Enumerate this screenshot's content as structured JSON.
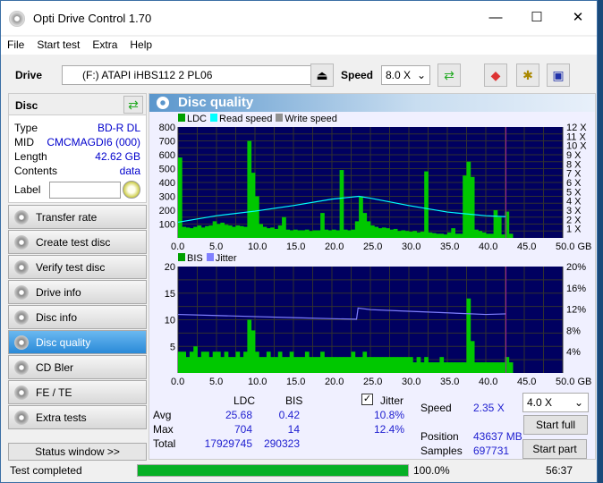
{
  "window": {
    "title": "Opti Drive Control 1.70",
    "minimize": "—",
    "maximize": "☐",
    "close": "✕"
  },
  "menu": [
    "File",
    "Start test",
    "Extra",
    "Help"
  ],
  "toolbar": {
    "drive_label": "Drive",
    "drive_value": "(F:)  ATAPI iHBS112  2 PL06",
    "speed_label": "Speed",
    "speed_value": "8.0 X"
  },
  "disc": {
    "header": "Disc",
    "rows": [
      {
        "k": "Type",
        "v": "BD-R DL"
      },
      {
        "k": "MID",
        "v": "CMCMAGDI6 (000)"
      },
      {
        "k": "Length",
        "v": "42.62 GB"
      },
      {
        "k": "Contents",
        "v": "data"
      }
    ],
    "label_key": "Label",
    "label_value": ""
  },
  "nav": [
    "Transfer rate",
    "Create test disc",
    "Verify test disc",
    "Drive info",
    "Disc info",
    "Disc quality",
    "CD Bler",
    "FE / TE",
    "Extra tests"
  ],
  "nav_active": 5,
  "status_window": "Status window >>",
  "panel_title": "Disc quality",
  "colors": {
    "ldc": "#00c800",
    "read": "#00ffff",
    "write": "#909090",
    "bis": "#00c800",
    "jitter": "#8080ff",
    "plot_bg": "#000060",
    "accent": "#2a8ad8"
  },
  "chart_data": [
    {
      "type": "bar",
      "legend": [
        "LDC",
        "Read speed",
        "Write speed"
      ],
      "xlim": [
        0,
        50
      ],
      "xunit": "GB",
      "ylim": [
        0,
        800
      ],
      "y2lim": [
        0,
        12
      ],
      "xticks": [
        "0.0",
        "5.0",
        "10.0",
        "15.0",
        "20.0",
        "25.0",
        "30.0",
        "35.0",
        "40.0",
        "45.0",
        "50.0 GB"
      ],
      "yticks": [
        "100",
        "200",
        "300",
        "400",
        "500",
        "600",
        "700",
        "800"
      ],
      "y2ticks": [
        "1 X",
        "2 X",
        "3 X",
        "4 X",
        "5 X",
        "6 X",
        "7 X",
        "8 X",
        "9 X",
        "10 X",
        "11 X",
        "12 X"
      ],
      "ldc_step_gb": 0.5,
      "ldc": [
        580,
        80,
        75,
        70,
        80,
        90,
        75,
        85,
        90,
        120,
        100,
        110,
        95,
        90,
        80,
        90,
        85,
        80,
        700,
        470,
        300,
        100,
        80,
        70,
        75,
        65,
        90,
        150,
        60,
        55,
        60,
        55,
        55,
        60,
        50,
        55,
        55,
        180,
        60,
        55,
        60,
        55,
        490,
        60,
        55,
        60,
        120,
        300,
        180,
        120,
        90,
        80,
        70,
        75,
        70,
        60,
        65,
        50,
        55,
        50,
        45,
        50,
        40,
        45,
        480,
        40,
        35,
        30,
        30,
        25,
        40,
        70,
        30,
        30,
        450,
        550,
        440,
        60,
        50,
        40,
        30,
        30,
        200,
        150,
        25,
        190,
        30
      ],
      "read_speed_x": [
        0,
        5,
        10,
        15,
        20,
        23.5,
        25,
        30,
        35,
        40,
        42.6
      ],
      "read_speed_y": [
        1.7,
        2.4,
        2.9,
        3.5,
        4.2,
        4.5,
        4.3,
        3.5,
        2.8,
        2.4,
        2.3
      ]
    },
    {
      "type": "bar",
      "legend": [
        "BIS",
        "Jitter"
      ],
      "xlim": [
        0,
        50
      ],
      "ylim": [
        0,
        20
      ],
      "y2lim": [
        0,
        20
      ],
      "xticks": [
        "0.0",
        "5.0",
        "10.0",
        "15.0",
        "20.0",
        "25.0",
        "30.0",
        "35.0",
        "40.0",
        "45.0",
        "50.0 GB"
      ],
      "yticks": [
        "5",
        "10",
        "15",
        "20"
      ],
      "y2ticks": [
        "4%",
        "8%",
        "12%",
        "16%",
        "20%"
      ],
      "bis_step_gb": 0.5,
      "bis": [
        4,
        4,
        3,
        4,
        5,
        3,
        4,
        4,
        3,
        4,
        4,
        3,
        4,
        3,
        3,
        4,
        3,
        4,
        10,
        8,
        4,
        3,
        3,
        4,
        3,
        3,
        4,
        3,
        3,
        4,
        3,
        3,
        3,
        4,
        3,
        3,
        3,
        4,
        3,
        3,
        3,
        3,
        3,
        3,
        3,
        4,
        3,
        3,
        4,
        3,
        3,
        3,
        3,
        3,
        3,
        3,
        3,
        3,
        3,
        3,
        3,
        2,
        3,
        2,
        3,
        2,
        2,
        2,
        3,
        2,
        2,
        2,
        2,
        2,
        2,
        14,
        6,
        2,
        2,
        2,
        2,
        2,
        2,
        2,
        2,
        3,
        2
      ],
      "jitter_x": [
        0,
        5,
        10,
        15,
        20,
        23.2,
        23.4,
        25,
        30,
        35,
        40,
        42.6
      ],
      "jitter_pct": [
        11.0,
        10.8,
        10.6,
        10.4,
        10.2,
        10.1,
        12.2,
        11.9,
        11.6,
        11.3,
        11.0,
        11.1
      ]
    }
  ],
  "stats": {
    "col_ldc": "LDC",
    "col_bis": "BIS",
    "jitter_label": "Jitter",
    "jitter_checked": true,
    "rows": [
      {
        "k": "Avg",
        "ldc": "25.68",
        "bis": "0.42",
        "jit": "10.8%"
      },
      {
        "k": "Max",
        "ldc": "704",
        "bis": "14",
        "jit": "12.4%"
      },
      {
        "k": "Total",
        "ldc": "17929745",
        "bis": "290323",
        "jit": ""
      }
    ],
    "speed_label": "Speed",
    "speed_value": "2.35 X",
    "position_label": "Position",
    "position_value": "43637 MB",
    "samples_label": "Samples",
    "samples_value": "697731",
    "speed_select": "4.0 X",
    "start_full": "Start full",
    "start_part": "Start part"
  },
  "statusbar": {
    "text": "Test completed",
    "progress": 100.0,
    "progress_text": "100.0%",
    "time": "56:37"
  }
}
